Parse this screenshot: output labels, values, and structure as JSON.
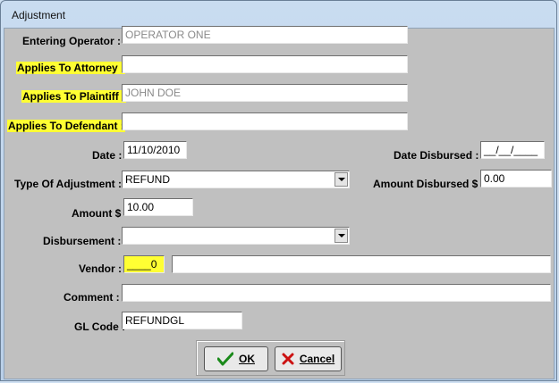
{
  "window": {
    "title": "Adjustment"
  },
  "labels": {
    "entering_operator": "Entering Operator :",
    "applies_attorney": "Applies To Attorney :",
    "applies_plaintiff": "Applies To Plaintiff :",
    "applies_defendant": "Applies To Defendant :",
    "date": "Date :",
    "date_disbursed": "Date Disbursed :",
    "type_of_adjustment": "Type Of Adjustment :",
    "amount_disbursed": "Amount Disbursed $",
    "amount": "Amount $",
    "disbursement": "Disbursement :",
    "vendor": "Vendor :",
    "comment": "Comment :",
    "gl_code": "GL Code :"
  },
  "values": {
    "entering_operator": "OPERATOR ONE",
    "applies_attorney": "",
    "applies_plaintiff": "JOHN DOE",
    "applies_defendant": "",
    "date": "11/10/2010",
    "date_disbursed": "__/__/____",
    "type_of_adjustment": "REFUND",
    "amount_disbursed": "0.00",
    "amount": "10.00",
    "disbursement": "",
    "vendor_code": "____0",
    "vendor_name": "",
    "comment": "",
    "gl_code": "REFUNDGL"
  },
  "buttons": {
    "ok_label": "OK",
    "cancel_label": "Cancel"
  },
  "colors": {
    "highlight": "#ffff33",
    "ok_check": "#1a8a1a",
    "cancel_x": "#cc1111"
  },
  "icons": {
    "ok": "check-icon",
    "cancel": "x-icon",
    "dropdown": "chevron-down-icon"
  }
}
